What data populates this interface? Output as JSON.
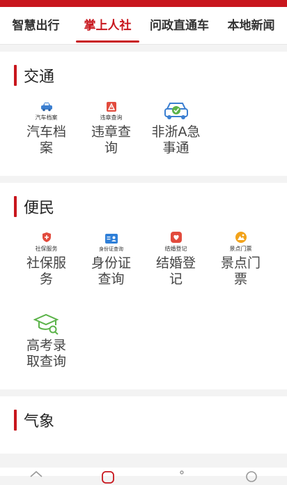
{
  "tabs": [
    {
      "label": "智慧出行",
      "active": false
    },
    {
      "label": "掌上人社",
      "active": true
    },
    {
      "label": "问政直通车",
      "active": false
    },
    {
      "label": "本地新闻",
      "active": false
    }
  ],
  "sections": {
    "traffic": {
      "title": "交通",
      "items": [
        {
          "icon": "car-icon",
          "small_label": "汽车档案",
          "label": "汽车档案"
        },
        {
          "icon": "warning-icon",
          "small_label": "违章查询",
          "label": "违章查询"
        },
        {
          "icon": "vehicle-shield-icon",
          "small_label": "",
          "label": "非浙A急事通"
        }
      ]
    },
    "convenience": {
      "title": "便民",
      "items": [
        {
          "icon": "social-security-icon",
          "small_label": "社保服务",
          "label": "社保服务"
        },
        {
          "icon": "id-card-icon",
          "small_label": "身份证查询",
          "label": "身份证查询"
        },
        {
          "icon": "marriage-icon",
          "small_label": "结婚登记",
          "label": "结婚登记"
        },
        {
          "icon": "ticket-icon",
          "small_label": "景点门票",
          "label": "景点门票"
        },
        {
          "icon": "graduation-cap-icon",
          "small_label": "",
          "label": "高考录取查询"
        }
      ]
    },
    "weather": {
      "title": "气象"
    }
  },
  "colors": {
    "brand_red": "#c8161d",
    "car_blue": "#3b7fd1",
    "warning_red": "#e24b3d",
    "id_blue": "#2f7fd8",
    "ticket_orange": "#f2a31b",
    "cap_green": "#5bb349"
  }
}
